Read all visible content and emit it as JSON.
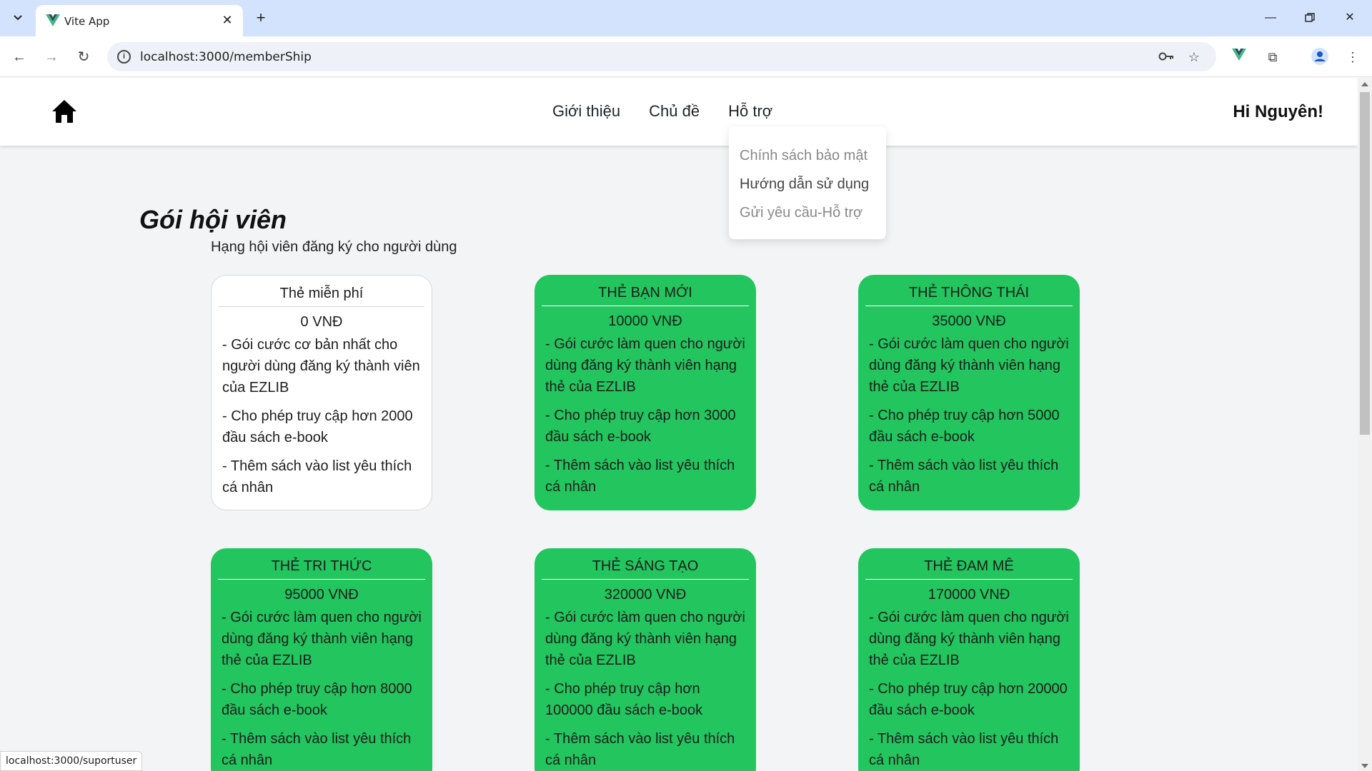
{
  "browser": {
    "tab_title": "Vite App",
    "url": "localhost:3000/memberShip",
    "status_url": "localhost:3000/suportuser"
  },
  "header": {
    "nav": [
      "Giới thiệu",
      "Chủ đề",
      "Hỗ trợ"
    ],
    "greeting": "Hi Nguyên!"
  },
  "dropdown": {
    "items": [
      "Chính sách bảo mật",
      "Hướng dẫn sử dụng",
      "Gửi yêu cầu-Hỗ trợ"
    ]
  },
  "page": {
    "title": "Gói hội viên",
    "subtitle": "Hạng hội viên đăng ký cho người dùng"
  },
  "cards": [
    {
      "name": "Thẻ miễn phí",
      "price": "0 VNĐ",
      "features": [
        "- Gói cước cơ bản nhất cho người dùng đăng ký thành viên của EZLIB",
        "- Cho phép truy cập hơn 2000 đầu sách e-book",
        "- Thêm sách vào list yêu thích cá nhân"
      ]
    },
    {
      "name": "THẺ BẠN MỚI",
      "price": "10000 VNĐ",
      "features": [
        "- Gói cước làm quen cho người dùng đăng ký thành viên hạng thẻ của EZLIB",
        "- Cho phép truy cập hơn 3000 đầu sách e-book",
        "- Thêm sách vào list yêu thích cá nhân"
      ]
    },
    {
      "name": "THẺ THÔNG THÁI",
      "price": "35000 VNĐ",
      "features": [
        "- Gói cước làm quen cho người dùng đăng ký thành viên hạng thẻ của EZLIB",
        "- Cho phép truy cập hơn 5000 đầu sách e-book",
        "- Thêm sách vào list yêu thích cá nhân"
      ]
    },
    {
      "name": "THẺ TRI THỨC",
      "price": "95000 VNĐ",
      "features": [
        "- Gói cước làm quen cho người dùng đăng ký thành viên hạng thẻ của EZLIB",
        "- Cho phép truy cập hơn 8000 đầu sách e-book",
        "- Thêm sách vào list yêu thích cá nhân"
      ]
    },
    {
      "name": "THẺ SÁNG TẠO",
      "price": "320000 VNĐ",
      "features": [
        "- Gói cước làm quen cho người dùng đăng ký thành viên hạng thẻ của EZLIB",
        "- Cho phép truy cập hơn 100000 đầu sách e-book",
        "- Thêm sách vào list yêu thích cá nhân"
      ]
    },
    {
      "name": "THẺ ĐAM MÊ",
      "price": "170000 VNĐ",
      "features": [
        "- Gói cước làm quen cho người dùng đăng ký thành viên hạng thẻ của EZLIB",
        "- Cho phép truy cập hơn 20000 đầu sách e-book",
        "- Thêm sách vào list yêu thích cá nhân"
      ]
    }
  ],
  "colors": {
    "paid_card": "#22c55e",
    "free_card": "#ffffff",
    "page_bg": "#f3f4f6",
    "browser_frame": "#d3e3fd"
  },
  "icons": [
    "tab-list-icon",
    "vue-logo-icon",
    "close-icon",
    "plus-icon",
    "minimize-icon",
    "restore-icon",
    "back-icon",
    "forward-icon",
    "reload-icon",
    "site-info-icon",
    "key-icon",
    "star-icon",
    "vue-devtools-icon",
    "extensions-icon",
    "profile-icon",
    "more-icon",
    "home-icon"
  ]
}
